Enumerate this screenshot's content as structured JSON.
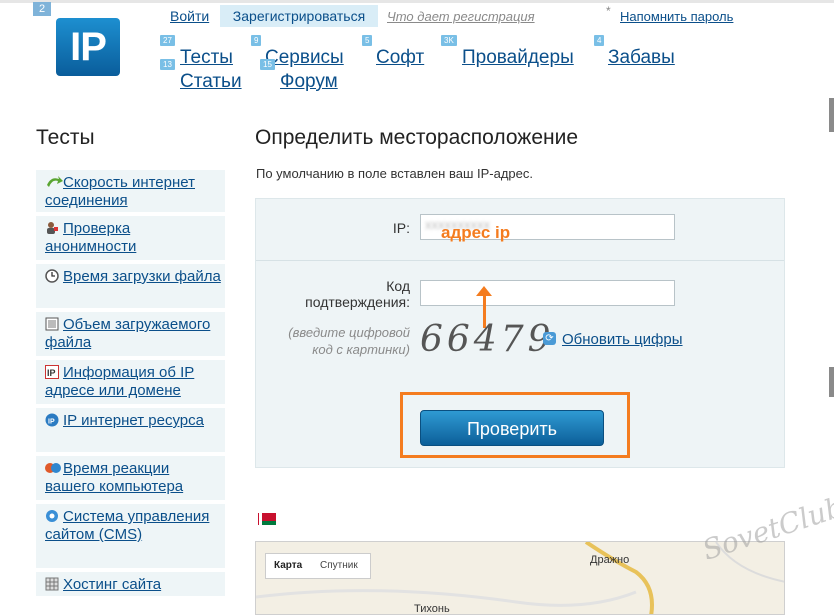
{
  "header": {
    "logo_text": "IP",
    "logo_badge": "2",
    "login": "Войти",
    "register": "Зарегистрироваться",
    "why_register": "Что дает регистрация",
    "star": "*",
    "remind_password": "Напомнить пароль"
  },
  "nav": {
    "items": [
      {
        "label": "Тесты",
        "badge": "27"
      },
      {
        "label": "Сервисы",
        "badge": "9"
      },
      {
        "label": "Софт",
        "badge": "5"
      },
      {
        "label": "Провайдеры",
        "badge": "3K"
      },
      {
        "label": "Забавы",
        "badge": "4"
      },
      {
        "label": "Статьи",
        "badge": "13"
      },
      {
        "label": "Форум",
        "badge": "15"
      }
    ]
  },
  "sidebar": {
    "title": "Тесты",
    "items": [
      {
        "label": "Скорость интернет соединения",
        "icon": "speed-arrow-icon"
      },
      {
        "label": "Проверка анонимности",
        "icon": "person-icon"
      },
      {
        "label": "Время загрузки файла",
        "icon": "clock-icon"
      },
      {
        "label": "Объем загружаемого файла",
        "icon": "monitor-icon"
      },
      {
        "label": "Информация об IP адресе или домене",
        "icon": "ip-box-icon"
      },
      {
        "label": "IP интернет ресурса",
        "icon": "ip-globe-icon"
      },
      {
        "label": "Время реакции вашего компьютера",
        "icon": "reaction-icon"
      },
      {
        "label": "Система управления сайтом (CMS)",
        "icon": "gear-icon"
      },
      {
        "label": "Хостинг сайта",
        "icon": "grid-icon"
      }
    ]
  },
  "main": {
    "title": "Определить месторасположение",
    "hint": "По умолчанию в поле вставлен ваш IP-адрес.",
    "form": {
      "ip_label": "IP:",
      "ip_value_blurred": "xxxxxxxxxx",
      "ip_annotation": "адрес ip",
      "code_label_line1": "Код",
      "code_label_line2": "подтверждения:",
      "captcha_note": "(введите цифровой код с картинки)",
      "captcha_digits": "66479",
      "refresh_label": "Обновить цифры",
      "submit_label": "Проверить"
    },
    "map": {
      "btn_map": "Карта",
      "btn_satellite": "Спутник",
      "places": [
        "Дражно",
        "Тихонь"
      ]
    }
  },
  "watermark": "SovetClub",
  "colors": {
    "accent": "#f47c1f",
    "link": "#0b4f8a",
    "button": "#1a7fc0"
  }
}
